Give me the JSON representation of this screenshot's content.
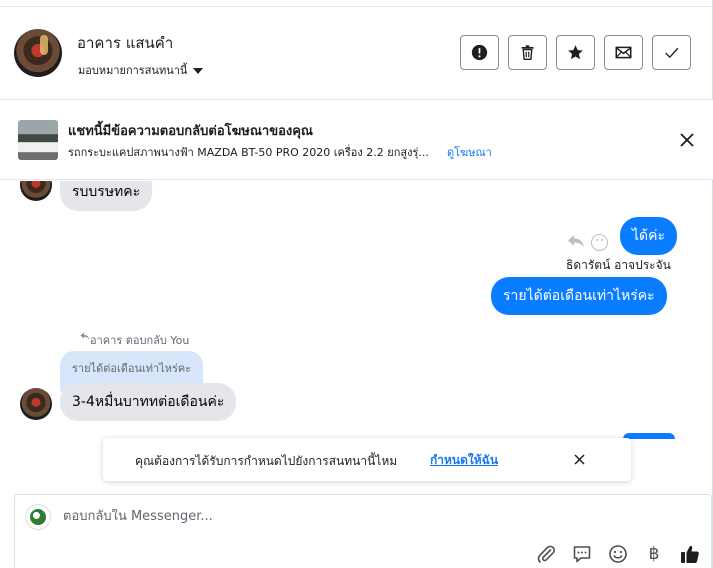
{
  "header": {
    "contact_name": "อาคาร แสนคำ",
    "assign_label": "มอบหมายการสนทนานี้",
    "actions": [
      {
        "icon": "alert-icon",
        "name": "mark-spam-button"
      },
      {
        "icon": "trash-icon",
        "name": "delete-button"
      },
      {
        "icon": "star-icon",
        "name": "star-button"
      },
      {
        "icon": "envelope-icon",
        "name": "mark-unread-button"
      },
      {
        "icon": "check-icon",
        "name": "mark-done-button"
      }
    ]
  },
  "ad_banner": {
    "title": "แชทนี้มีข้อความตอบกลับต่อโฆษณาของคุณ",
    "description": "รถกระบะแคปสภาพนางฟ้า MAZDA BT-50 PRO 2020 เครื่อง 2.2 ยกสูงรุ่...",
    "link_label": "ดูโฆษณา"
  },
  "conversation": {
    "partial_incoming": "รบบรษทคะ",
    "outgoing_1": "ได้ค่ะ",
    "sender_name": "ธิดารัตน์ อาจประจัน",
    "outgoing_2": "รายได้ต่อเดือนเท่าไหร่คะ",
    "reply_meta": "อาคาร ตอบกลับ You",
    "quoted_text": "รายได้ต่อเดือนเท่าไหร่คะ",
    "incoming_reply": "3-4หมื่นบาททต่อเดือนค่ะ"
  },
  "reminder": {
    "text": "คุณต้องการได้รับการกำหนดไปยังการสนทนานี้ไหม",
    "link_label": "กำหนดให้ฉัน"
  },
  "composer": {
    "placeholder": "ตอบกลับใน Messenger...",
    "tools": [
      "paperclip-icon",
      "comment-icon",
      "emoji-icon",
      "baht-icon",
      "thumbs-up-icon"
    ],
    "baht_symbol": "฿"
  },
  "colors": {
    "accent": "#1877f2",
    "outgoing_bubble": "#0a7cff",
    "incoming_bubble": "#e4e6eb",
    "quoted_bubble": "#d8e6fb"
  }
}
